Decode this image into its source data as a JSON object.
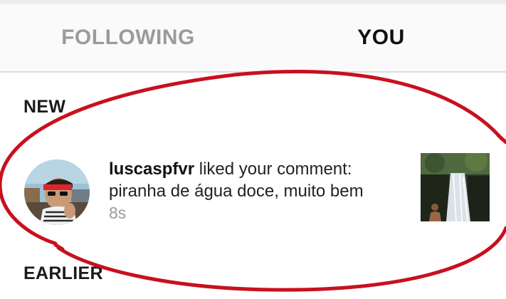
{
  "tabs": {
    "following_label": "FOLLOWING",
    "you_label": "YOU",
    "active": "YOU"
  },
  "sections": {
    "new_label": "NEW",
    "earlier_label": "EARLIER"
  },
  "notification": {
    "username": "luscaspfvr",
    "action": " liked your comment:",
    "comment": "piranha de água doce, muito bem",
    "time": "8s"
  },
  "colors": {
    "active_tab": "#111111",
    "inactive_tab": "#9b9b9b",
    "timestamp": "#9a9a9a",
    "annotation": "#c8101e"
  }
}
